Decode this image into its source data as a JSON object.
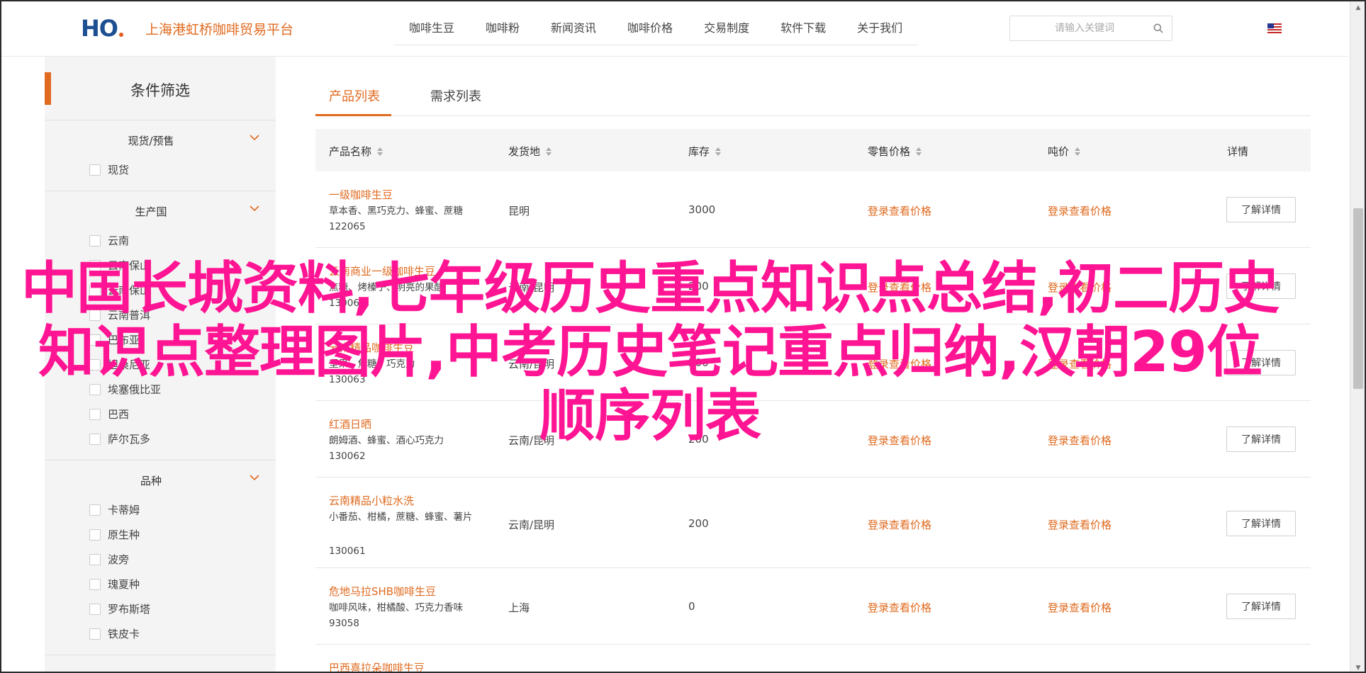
{
  "header": {
    "logo_text": "HO",
    "site_name": "上海港虹桥咖啡贸易平台",
    "nav": [
      "咖啡生豆",
      "咖啡粉",
      "新闻资讯",
      "咖啡价格",
      "交易制度",
      "软件下载",
      "关于我们"
    ],
    "search_placeholder": "请输入关键词",
    "language_flag": "us-flag-icon"
  },
  "sidebar": {
    "title": "条件筛选",
    "groups": [
      {
        "title": "现货/预售",
        "options": [
          "现货"
        ]
      },
      {
        "title": "生产国",
        "options": [
          "云南",
          "云南保山",
          "云南保山",
          "云南普洱",
          "巴布亚",
          "坦桑尼亚",
          "埃塞俄比亚",
          "巴西",
          "萨尔瓦多"
        ]
      },
      {
        "title": "品种",
        "options": [
          "卡蒂姆",
          "原生种",
          "波旁",
          "瑰夏种",
          "罗布斯塔",
          "铁皮卡"
        ]
      }
    ]
  },
  "main": {
    "tabs": [
      "产品列表",
      "需求列表"
    ],
    "columns": [
      "产品名称",
      "发货地",
      "库存",
      "零售价格",
      "吨价",
      "详情"
    ],
    "login_text": "登录查看价格",
    "detail_label": "了解详情",
    "rows": [
      {
        "name": "一级咖啡生豆",
        "desc": "草本香、黑巧克力、蜂蜜、蔗糖",
        "code": "122065",
        "origin": "昆明",
        "stock": "3000"
      },
      {
        "name": "云南商业一级咖啡生豆",
        "desc": "焦糖、烤榛子、明亮的果酸",
        "code": "130064",
        "origin": "云南/昆明",
        "stock": "200"
      },
      {
        "name": "云南精品咖啡生豆",
        "desc": "坚果、焦糖、巧克力",
        "code": "130063",
        "origin": "云南/昆明",
        "stock": "200"
      },
      {
        "name": "红酒日晒",
        "desc": "朗姆酒、蜂蜜、酒心巧克力",
        "code": "130062",
        "origin": "云南/昆明",
        "stock": "200"
      },
      {
        "name": "云南精品小粒水洗",
        "desc": "小番茄、柑橘，蔗糖、蜂蜜、薯片",
        "code": "130061",
        "origin": "云南/昆明",
        "stock": "200"
      },
      {
        "name": "危地马拉SHB咖啡生豆",
        "desc": "咖啡风味，柑橘酸、巧克力香味",
        "code": "93058",
        "origin": "上海",
        "stock": "0"
      },
      {
        "name": "巴西喜拉朵咖啡生豆",
        "desc": "",
        "code": "",
        "origin": "",
        "stock": ""
      }
    ]
  },
  "overlay_title": "中国长城资料,七年级历史重点知识点总结,初二历史知识点整理图片,中考历史笔记重点归纳,汉朝29位 顺序列表",
  "colors": {
    "accent": "#e06a1f",
    "overlay": "#ff1493",
    "sidebar_bg": "#f4f4f4",
    "logo_blue": "#1d4f91"
  }
}
